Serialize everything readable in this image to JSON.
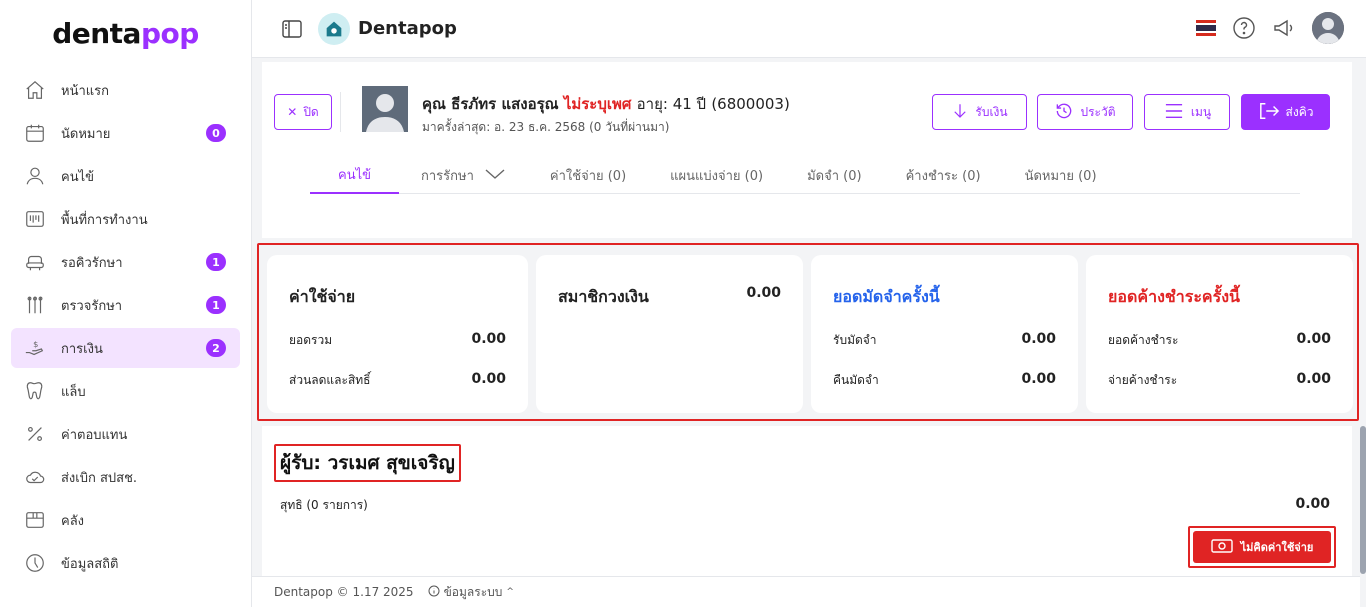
{
  "app": {
    "logo_main": "denta",
    "logo_accent": "pop",
    "brand_name": "Dentapop",
    "accent_color": "#9b30ff",
    "danger_color": "#e02424"
  },
  "sidebar": {
    "items": [
      {
        "label": "หน้าแรก",
        "icon": "home-icon",
        "badge": ""
      },
      {
        "label": "นัดหมาย",
        "icon": "calendar-icon",
        "badge": "0"
      },
      {
        "label": "คนไข้",
        "icon": "user-icon",
        "badge": ""
      },
      {
        "label": "พื้นที่การทำงาน",
        "icon": "workspace-icon",
        "badge": ""
      },
      {
        "label": "รอคิวรักษา",
        "icon": "dental-chair-icon",
        "badge": "1"
      },
      {
        "label": "ตรวจรักษา",
        "icon": "dental-tools-icon",
        "badge": "1"
      },
      {
        "label": "การเงิน",
        "icon": "money-hand-icon",
        "badge": "2"
      },
      {
        "label": "แล็บ",
        "icon": "tooth-icon",
        "badge": ""
      },
      {
        "label": "ค่าตอบแทน",
        "icon": "percent-icon",
        "badge": ""
      },
      {
        "label": "ส่งเบิก สปสช.",
        "icon": "cloud-check-icon",
        "badge": ""
      },
      {
        "label": "คลัง",
        "icon": "box-icon",
        "badge": ""
      },
      {
        "label": "ข้อมูลสถิติ",
        "icon": "stats-icon",
        "badge": ""
      }
    ]
  },
  "patient": {
    "close_label": "ปิด",
    "name": "คุณ ธีรภัทร แสงอรุณ",
    "gender": "ไม่ระบุเพศ",
    "age": "อายุ: 41 ปี",
    "hn": "(6800003)",
    "last_visit": "มาครั้งล่าสุด: อ. 23 ธ.ค. 2568 (0 วันที่ผ่านมา)",
    "actions": {
      "receive_money": "รับเงิน",
      "history": "ประวัติ",
      "menu": "เมนู",
      "send_queue": "ส่งคิว"
    }
  },
  "tabs": [
    {
      "label": "คนไข้",
      "active": true
    },
    {
      "label": "การรักษา",
      "active": false
    },
    {
      "label": "ค่าใช้จ่าย (0)",
      "active": false
    },
    {
      "label": "แผนแบ่งจ่าย (0)",
      "active": false
    },
    {
      "label": "มัดจำ (0)",
      "active": false
    },
    {
      "label": "ค้างชำระ (0)",
      "active": false
    },
    {
      "label": "นัดหมาย (0)",
      "active": false
    }
  ],
  "summary": {
    "expenses": {
      "title": "ค่าใช้จ่าย",
      "total_label": "ยอดรวม",
      "total_value": "0.00",
      "discount_label": "ส่วนลดและสิทธิ์",
      "discount_value": "0.00"
    },
    "membership": {
      "title": "สมาชิกวงเงิน",
      "value": "0.00"
    },
    "deposit": {
      "title": "ยอดมัดจำครั้งนี้",
      "receive_label": "รับมัดจำ",
      "receive_value": "0.00",
      "refund_label": "คืนมัดจำ",
      "refund_value": "0.00"
    },
    "outstanding": {
      "title": "ยอดค้างชำระครั้งนี้",
      "outstanding_label": "ยอดค้างชำระ",
      "outstanding_value": "0.00",
      "pay_label": "จ่ายค้างชำระ",
      "pay_value": "0.00"
    }
  },
  "recipient": {
    "title": "ผู้รับ: วรเมศ สุขเจริญ",
    "net_label": "สุทธิ (0 รายการ)",
    "net_value": "0.00",
    "no_charge_label": "ไม่คิดค่าใช้จ่าย"
  },
  "footer": {
    "version": "Dentapop © 1.17 2025",
    "system_info": "ข้อมูลระบบ"
  }
}
